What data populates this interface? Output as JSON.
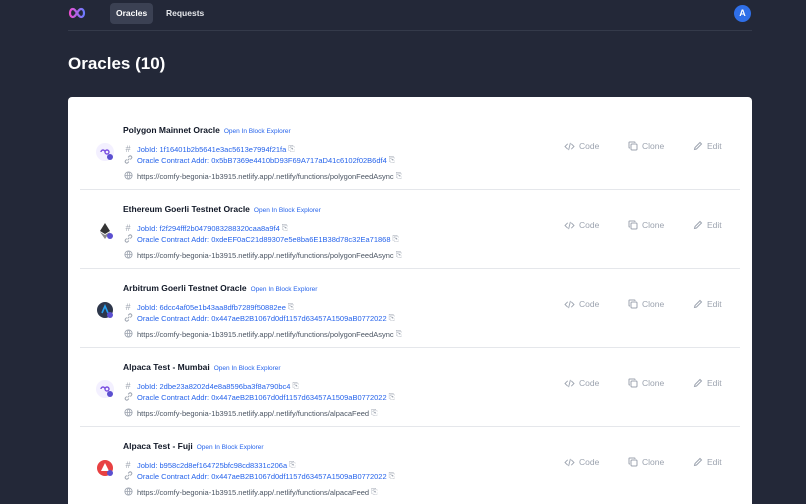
{
  "nav": {
    "tabs": [
      {
        "label": "Oracles",
        "active": true
      },
      {
        "label": "Requests",
        "active": false
      }
    ],
    "avatar_initial": "A"
  },
  "page": {
    "title": "Oracles (10)"
  },
  "oracles": [
    {
      "name": "Polygon Mainnet Oracle",
      "explorer_label": "Open In Block Explorer",
      "job_id": "JobId: 1f16401b2b5641e3ac5613e7994f21fa",
      "contract_addr": "Oracle Contract Addr: 0x5bB7369e4410bD93F69A717aD41c6102f02B6df4",
      "url": "https://comfy-begonia-1b3915.netlify.app/.netlify/functions/polygonFeedAsync",
      "icon": "polygon-icon"
    },
    {
      "name": "Ethereum Goerli Testnet Oracle",
      "explorer_label": "Open In Block Explorer",
      "job_id": "JobId: f2f294fff2b0479083288320caa8a9f4",
      "contract_addr": "Oracle Contract Addr: 0xdeEF0aC21d89307e5e8ba6E1B38d78c32Ea71868",
      "url": "https://comfy-begonia-1b3915.netlify.app/.netlify/functions/polygonFeedAsync",
      "icon": "ethereum-icon"
    },
    {
      "name": "Arbitrum Goerli Testnet Oracle",
      "explorer_label": "Open In Block Explorer",
      "job_id": "JobId: 6dcc4af05e1b43aa8dfb7289f50882ee",
      "contract_addr": "Oracle Contract Addr: 0x447aeB2B1067d0df1157d63457A1509aB0772022",
      "url": "https://comfy-begonia-1b3915.netlify.app/.netlify/functions/polygonFeedAsync",
      "icon": "arbitrum-icon"
    },
    {
      "name": "Alpaca Test - Mumbai",
      "explorer_label": "Open In Block Explorer",
      "job_id": "JobId: 2dbe23a8202d4e8a8596ba3f8a790bc4",
      "contract_addr": "Oracle Contract Addr: 0x447aeB2B1067d0df1157d63457A1509aB0772022",
      "url": "https://comfy-begonia-1b3915.netlify.app/.netlify/functions/alpacaFeed",
      "icon": "polygon-icon"
    },
    {
      "name": "Alpaca Test - Fuji",
      "explorer_label": "Open In Block Explorer",
      "job_id": "JobId: b958c2d8ef164725bfc98cd8331c206a",
      "contract_addr": "Oracle Contract Addr: 0x447aeB2B1067d0df1157d63457A1509aB0772022",
      "url": "https://comfy-begonia-1b3915.netlify.app/.netlify/functions/alpacaFeed",
      "icon": "avalanche-icon"
    }
  ],
  "actions": {
    "code": "Code",
    "clone": "Clone",
    "edit": "Edit"
  },
  "colors": {
    "background": "#232838",
    "link": "#2563eb",
    "avatar": "#2f6fe8",
    "muted": "#9ca3af"
  }
}
